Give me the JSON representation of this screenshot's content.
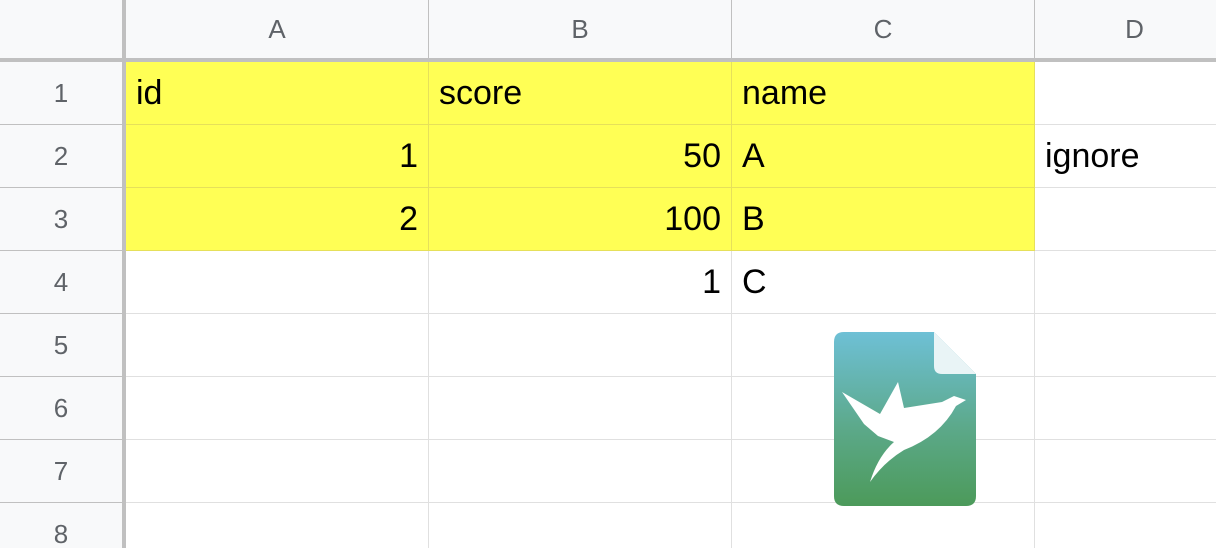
{
  "columns": [
    "A",
    "B",
    "C",
    "D"
  ],
  "rows": [
    "1",
    "2",
    "3",
    "4",
    "5",
    "6",
    "7",
    "8"
  ],
  "cells": {
    "r1": {
      "a": "id",
      "b": "score",
      "c": "name",
      "d": ""
    },
    "r2": {
      "a": "1",
      "b": "50",
      "c": "A",
      "d": "ignore"
    },
    "r3": {
      "a": "2",
      "b": "100",
      "c": "B",
      "d": ""
    },
    "r4": {
      "a": "",
      "b": "1",
      "c": "C",
      "d": ""
    }
  },
  "highlight_color": "#ffff55",
  "overlay_icon": "bird-document-icon"
}
